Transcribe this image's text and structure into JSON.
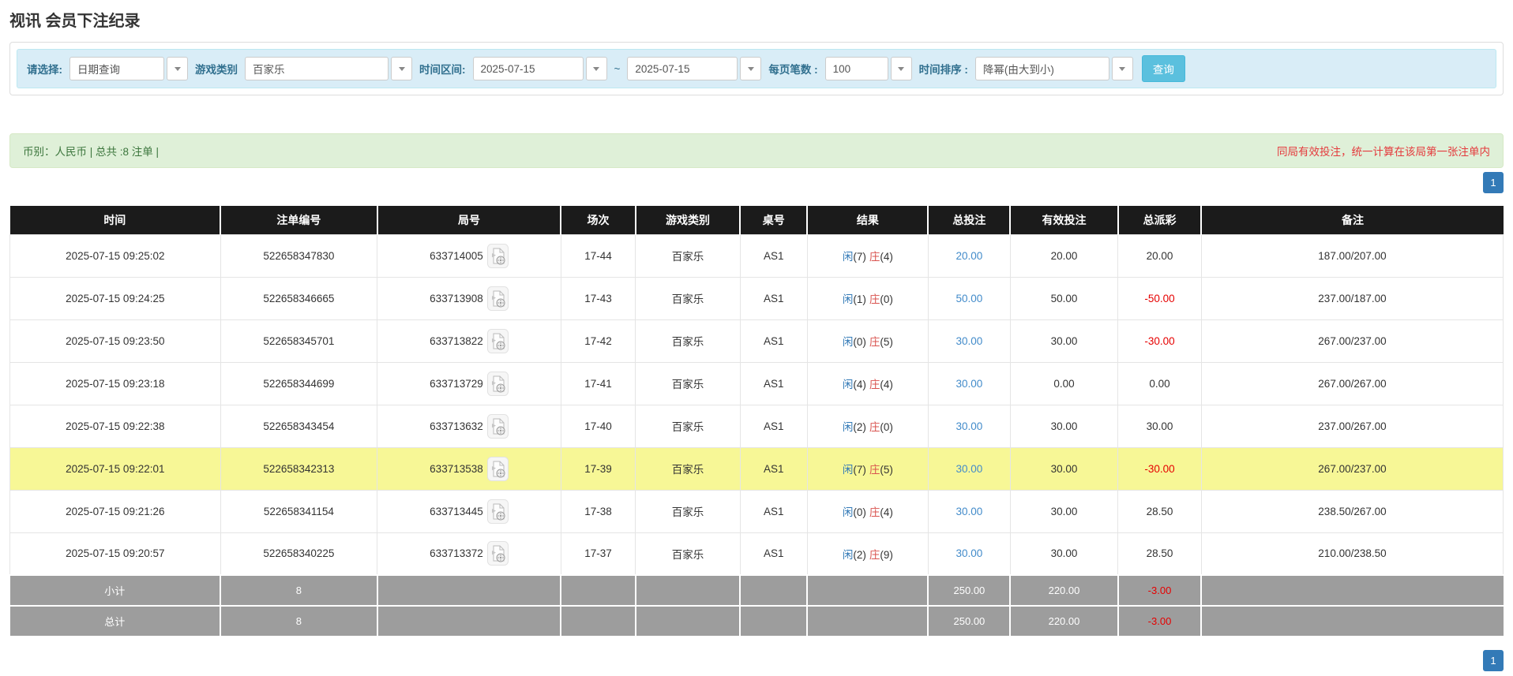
{
  "page": {
    "title": "视讯 会员下注纪录"
  },
  "filters": {
    "query_type_label": "请选择:",
    "query_type_value": "日期查询",
    "game_label": "游戏类别",
    "game_value": "百家乐",
    "range_label": "时间区间:",
    "date_from": "2025-07-15",
    "tilde": "~",
    "date_to": "2025-07-15",
    "page_size_label": "每页笔数 :",
    "page_size_value": "100",
    "sort_label": "时间排序 :",
    "sort_value": "降幂(由大到小)",
    "search_button": "查询"
  },
  "summary_bar": {
    "left": "币别：人民币 | 总共 :8 注单 |",
    "note": "同局有效投注，统一计算在该局第一张注单内"
  },
  "pagination": {
    "page": "1"
  },
  "table": {
    "columns": [
      "时间",
      "注单编号",
      "局号",
      "场次",
      "游戏类别",
      "桌号",
      "结果",
      "总投注",
      "有效投注",
      "总派彩",
      "备注"
    ],
    "rows": [
      {
        "time": "2025-07-15 09:25:02",
        "bet_id": "522658347830",
        "round_id": "633714005",
        "session": "17-44",
        "game": "百家乐",
        "table_no": "AS1",
        "result": {
          "player": "闲",
          "player_n": "(7)",
          "banker": "庄",
          "banker_n": "(4)"
        },
        "total_bet": "20.00",
        "valid_bet": "20.00",
        "payout": "20.00",
        "payout_negative": false,
        "remark": "187.00/207.00",
        "highlight": false
      },
      {
        "time": "2025-07-15 09:24:25",
        "bet_id": "522658346665",
        "round_id": "633713908",
        "session": "17-43",
        "game": "百家乐",
        "table_no": "AS1",
        "result": {
          "player": "闲",
          "player_n": "(1)",
          "banker": "庄",
          "banker_n": "(0)"
        },
        "total_bet": "50.00",
        "valid_bet": "50.00",
        "payout": "-50.00",
        "payout_negative": true,
        "remark": "237.00/187.00",
        "highlight": false
      },
      {
        "time": "2025-07-15 09:23:50",
        "bet_id": "522658345701",
        "round_id": "633713822",
        "session": "17-42",
        "game": "百家乐",
        "table_no": "AS1",
        "result": {
          "player": "闲",
          "player_n": "(0)",
          "banker": "庄",
          "banker_n": "(5)"
        },
        "total_bet": "30.00",
        "valid_bet": "30.00",
        "payout": "-30.00",
        "payout_negative": true,
        "remark": "267.00/237.00",
        "highlight": false
      },
      {
        "time": "2025-07-15 09:23:18",
        "bet_id": "522658344699",
        "round_id": "633713729",
        "session": "17-41",
        "game": "百家乐",
        "table_no": "AS1",
        "result": {
          "player": "闲",
          "player_n": "(4)",
          "banker": "庄",
          "banker_n": "(4)"
        },
        "total_bet": "30.00",
        "valid_bet": "0.00",
        "payout": "0.00",
        "payout_negative": false,
        "remark": "267.00/267.00",
        "highlight": false
      },
      {
        "time": "2025-07-15 09:22:38",
        "bet_id": "522658343454",
        "round_id": "633713632",
        "session": "17-40",
        "game": "百家乐",
        "table_no": "AS1",
        "result": {
          "player": "闲",
          "player_n": "(2)",
          "banker": "庄",
          "banker_n": "(0)"
        },
        "total_bet": "30.00",
        "valid_bet": "30.00",
        "payout": "30.00",
        "payout_negative": false,
        "remark": "237.00/267.00",
        "highlight": false
      },
      {
        "time": "2025-07-15 09:22:01",
        "bet_id": "522658342313",
        "round_id": "633713538",
        "session": "17-39",
        "game": "百家乐",
        "table_no": "AS1",
        "result": {
          "player": "闲",
          "player_n": "(7)",
          "banker": "庄",
          "banker_n": "(5)"
        },
        "total_bet": "30.00",
        "valid_bet": "30.00",
        "payout": "-30.00",
        "payout_negative": true,
        "remark": "267.00/237.00",
        "highlight": true
      },
      {
        "time": "2025-07-15 09:21:26",
        "bet_id": "522658341154",
        "round_id": "633713445",
        "session": "17-38",
        "game": "百家乐",
        "table_no": "AS1",
        "result": {
          "player": "闲",
          "player_n": "(0)",
          "banker": "庄",
          "banker_n": "(4)"
        },
        "total_bet": "30.00",
        "valid_bet": "30.00",
        "payout": "28.50",
        "payout_negative": false,
        "remark": "238.50/267.00",
        "highlight": false
      },
      {
        "time": "2025-07-15 09:20:57",
        "bet_id": "522658340225",
        "round_id": "633713372",
        "session": "17-37",
        "game": "百家乐",
        "table_no": "AS1",
        "result": {
          "player": "闲",
          "player_n": "(2)",
          "banker": "庄",
          "banker_n": "(9)"
        },
        "total_bet": "30.00",
        "valid_bet": "30.00",
        "payout": "28.50",
        "payout_negative": false,
        "remark": "210.00/238.50",
        "highlight": false
      }
    ],
    "subtotal": {
      "label": "小计",
      "count": "8",
      "total_bet": "250.00",
      "valid_bet": "220.00",
      "payout": "-3.00"
    },
    "total": {
      "label": "总计",
      "count": "8",
      "total_bet": "250.00",
      "valid_bet": "220.00",
      "payout": "-3.00"
    }
  },
  "colors": {
    "accent_blue": "#337ab7",
    "link_blue": "#428bca",
    "player_blue": "#337ab7",
    "banker_red": "#d9534f",
    "negative_red": "#e60000",
    "note_red": "#e4393c",
    "success_green": "#3c763d",
    "success_bg": "#dff0d8",
    "info_bg": "#d9edf7",
    "info_border": "#bce8f1",
    "search_button_bg": "#5bc0de",
    "header_bg": "#1b1b1b",
    "highlight_yellow": "#f7f796",
    "summary_gray": "#9d9d9d"
  }
}
